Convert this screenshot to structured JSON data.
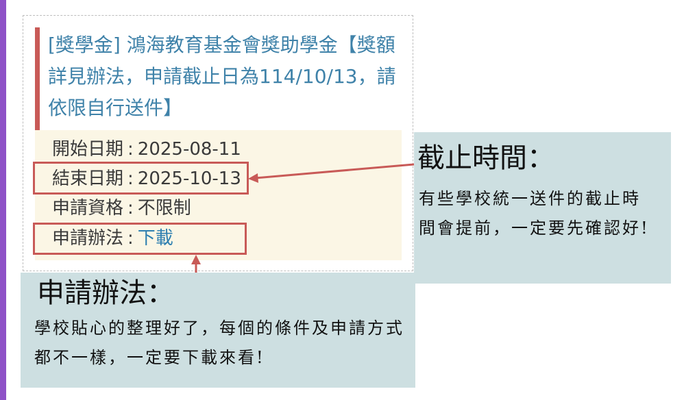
{
  "scholarship": {
    "title_parts": {
      "tag": "[獎學金]",
      "name": " 鴻海教育基金會獎助學金【獎額詳見辦法，申請截止日為114/10/13，請依限自行送件】"
    },
    "fields": [
      {
        "label": "開始日期",
        "value": "2025-08-11"
      },
      {
        "label": "結束日期",
        "value": "2025-10-13"
      },
      {
        "label": "申請資格",
        "value": "不限制"
      },
      {
        "label": "申請辦法",
        "value": "下載"
      }
    ]
  },
  "notes": {
    "deadline": {
      "heading": "截止時間：",
      "body": "有些學校統一送件的截止時間會提前，一定要先確認好!"
    },
    "method": {
      "heading": "申請辦法：",
      "body": "學校貼心的整理好了，每個的條件及申請方式都不一樣，一定要下載來看!"
    }
  },
  "colors": {
    "accent_red": "#c85a57",
    "link_blue": "#2e7fb0",
    "title_blue": "#3f82a9",
    "note_bg": "#cddfe1",
    "panel_bg": "#fbf6e5",
    "side_bar": "#8e52c7"
  }
}
